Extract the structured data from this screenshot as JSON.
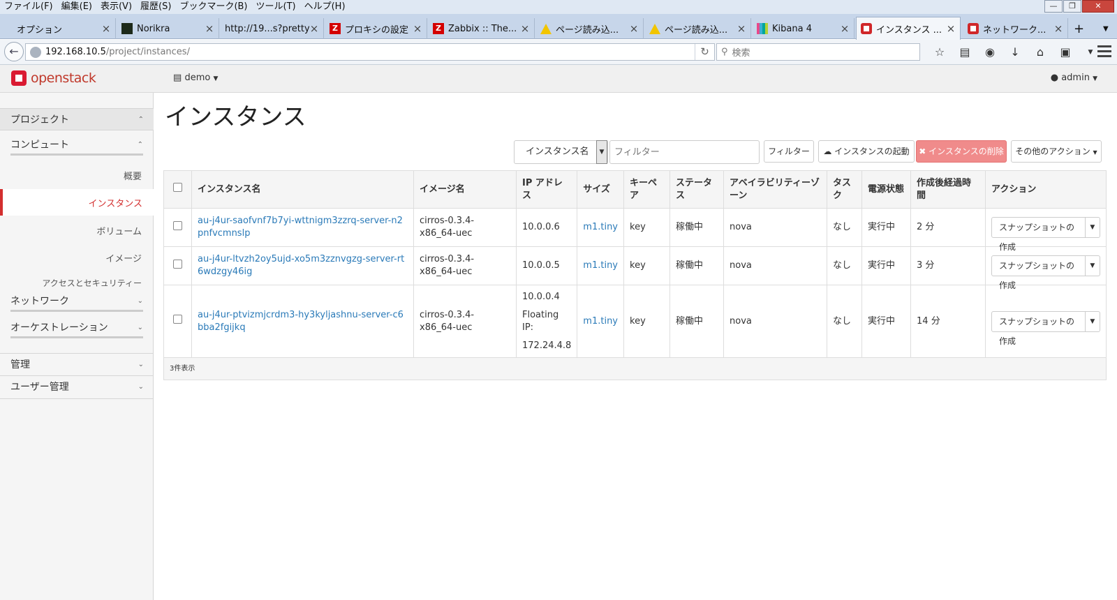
{
  "menubar": {
    "items": [
      "ファイル(F)",
      "編集(E)",
      "表示(V)",
      "履歴(S)",
      "ブックマーク(B)",
      "ツール(T)",
      "ヘルプ(H)"
    ]
  },
  "tabs": [
    {
      "label": "オプション",
      "icon": "none"
    },
    {
      "label": "Norikra",
      "icon": "norikra-icon"
    },
    {
      "label": "http://19...s?pretty",
      "icon": "none"
    },
    {
      "label": "プロキシの設定",
      "icon": "zabbix-icon"
    },
    {
      "label": "Zabbix :: The...",
      "icon": "zabbix-icon"
    },
    {
      "label": "ページ読み込...",
      "icon": "warning-icon"
    },
    {
      "label": "ページ読み込...",
      "icon": "warning-icon"
    },
    {
      "label": "Kibana 4",
      "icon": "kibana-icon"
    },
    {
      "label": "インスタンス ...",
      "icon": "openstack-icon"
    },
    {
      "label": "ネットワーク...",
      "icon": "openstack-icon"
    }
  ],
  "urlbar": {
    "host": "192.168.10.5",
    "path": "/project/instances/"
  },
  "search": {
    "placeholder": "検索"
  },
  "header": {
    "brand": "openstack",
    "project": "demo",
    "user": "admin"
  },
  "sidebar": {
    "project": "プロジェクト",
    "compute": "コンピュート",
    "overview": "概要",
    "instances": "インスタンス",
    "volumes": "ボリューム",
    "images": "イメージ",
    "access": "アクセスとセキュリティー",
    "network": "ネットワーク",
    "orchestration": "オーケストレーション",
    "admin": "管理",
    "identity": "ユーザー管理"
  },
  "page": {
    "title": "インスタンス"
  },
  "toolbar": {
    "filter_field": "インスタンス名",
    "filter_placeholder": "フィルター",
    "filter_button": "フィルター",
    "launch_button": "インスタンスの起動",
    "delete_button": "インスタンスの削除",
    "more_actions": "その他のアクション"
  },
  "table": {
    "headers": {
      "name": "インスタンス名",
      "image": "イメージ名",
      "ip": "IP アドレス",
      "size": "サイズ",
      "keypair": "キーペア",
      "status": "ステータス",
      "az": "アベイラビリティーゾーン",
      "task": "タスク",
      "power": "電源状態",
      "age": "作成後経過時間",
      "actions": "アクション"
    },
    "rows": [
      {
        "name": "au-j4ur-saofvnf7b7yi-wttnigm3zzrq-server-n2pnfvcmnslp",
        "image": "cirros-0.3.4-x86_64-uec",
        "ip": "10.0.0.6",
        "size": "m1.tiny",
        "keypair": "key",
        "status": "稼働中",
        "az": "nova",
        "task": "なし",
        "power": "実行中",
        "age": "2 分",
        "action": "スナップショットの作成"
      },
      {
        "name": "au-j4ur-ltvzh2oy5ujd-xo5m3zznvgzg-server-rt6wdzgy46ig",
        "image": "cirros-0.3.4-x86_64-uec",
        "ip": "10.0.0.5",
        "size": "m1.tiny",
        "keypair": "key",
        "status": "稼働中",
        "az": "nova",
        "task": "なし",
        "power": "実行中",
        "age": "3 分",
        "action": "スナップショットの作成"
      },
      {
        "name": "au-j4ur-ptvizmjcrdm3-hy3kyljashnu-server-c6bba2fgijkq",
        "image": "cirros-0.3.4-x86_64-uec",
        "ip": "10.0.0.4",
        "floating_label": "Floating IP:",
        "floating_ip": "172.24.4.8",
        "size": "m1.tiny",
        "keypair": "key",
        "status": "稼働中",
        "az": "nova",
        "task": "なし",
        "power": "実行中",
        "age": "14 分",
        "action": "スナップショットの作成"
      }
    ],
    "footer": "3件表示"
  }
}
